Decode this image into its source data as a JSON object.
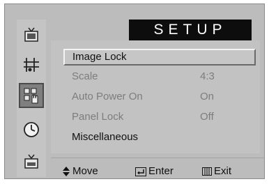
{
  "header": {
    "title": "SETUP"
  },
  "sidebar": {
    "items": [
      {
        "icon": "picture-icon"
      },
      {
        "icon": "sound-icon"
      },
      {
        "icon": "setup-icon",
        "active": true
      },
      {
        "icon": "clock-icon"
      },
      {
        "icon": "input-icon"
      }
    ]
  },
  "menu": {
    "image_lock": "Image Lock",
    "scale": {
      "label": "Scale",
      "value": "4:3"
    },
    "auto_power_on": {
      "label": "Auto Power On",
      "value": "On"
    },
    "panel_lock": {
      "label": "Panel Lock",
      "value": "Off"
    },
    "misc": "Miscellaneous"
  },
  "footer": {
    "move": "Move",
    "enter": "Enter",
    "exit": "Exit"
  }
}
